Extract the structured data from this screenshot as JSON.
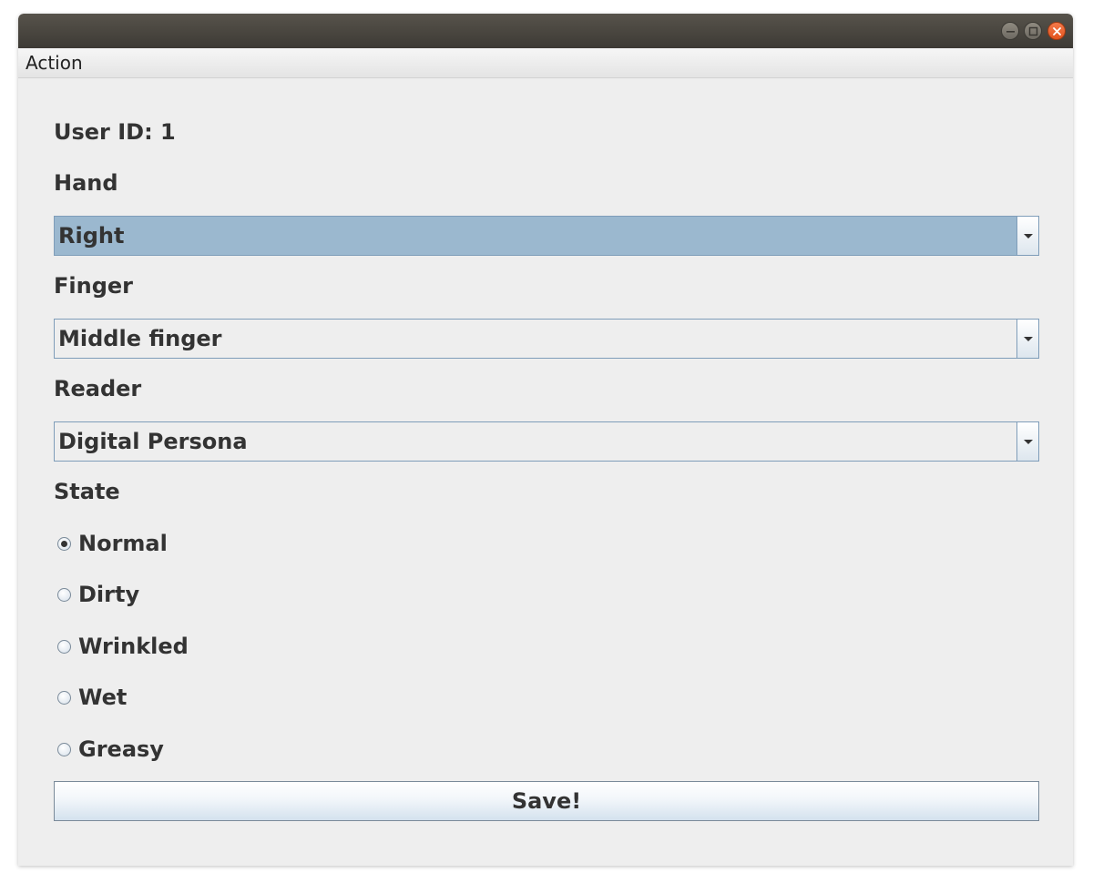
{
  "window": {
    "controls": {
      "minimize_icon": "minimize-icon",
      "maximize_icon": "maximize-icon",
      "close_icon": "close-icon",
      "close_color": "#e95420"
    }
  },
  "menubar": {
    "items": [
      {
        "label": "Action"
      }
    ]
  },
  "form": {
    "user_id_label": "User ID: 1",
    "hand": {
      "label": "Hand",
      "selected": "Right"
    },
    "finger": {
      "label": "Finger",
      "selected": "Middle finger"
    },
    "reader": {
      "label": "Reader",
      "selected": "Digital Persona"
    },
    "state": {
      "label": "State",
      "options": [
        {
          "label": "Normal",
          "checked": true
        },
        {
          "label": "Dirty",
          "checked": false
        },
        {
          "label": "Wrinkled",
          "checked": false
        },
        {
          "label": "Wet",
          "checked": false
        },
        {
          "label": "Greasy",
          "checked": false
        }
      ]
    },
    "save_label": "Save!"
  },
  "colors": {
    "background": "#eeeeee",
    "selected_combo": "#9bb8cf",
    "border": "#7f9db9",
    "text": "#333333"
  }
}
